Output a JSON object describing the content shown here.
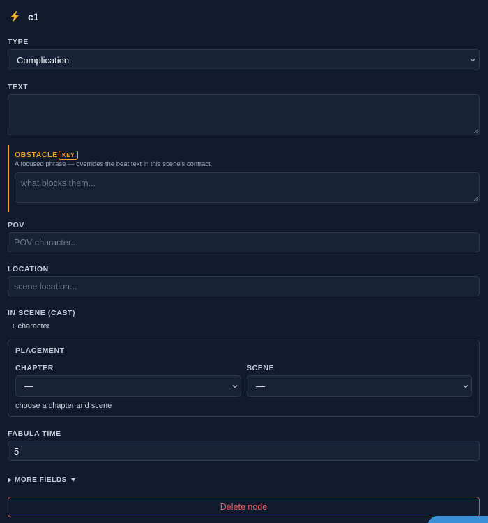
{
  "header": {
    "icon": "lightning-icon",
    "title": "c1"
  },
  "type_field": {
    "label": "TYPE",
    "value": "Complication"
  },
  "text_field": {
    "label": "TEXT",
    "value": ""
  },
  "obstacle": {
    "label": "OBSTACLE",
    "badge": "KEY",
    "help": "A focused phrase — overrides the beat text in this scene's contract.",
    "placeholder": "what blocks them...",
    "accent_color": "#f5a524"
  },
  "pov": {
    "label": "POV",
    "placeholder": "POV character..."
  },
  "location": {
    "label": "LOCATION",
    "placeholder": "scene location..."
  },
  "cast": {
    "label": "IN SCENE (CAST)",
    "add_label": "+ character"
  },
  "placement": {
    "label": "PLACEMENT",
    "chapter_label": "CHAPTER",
    "chapter_value": "—",
    "scene_label": "SCENE",
    "scene_value": "—",
    "hint": "choose a chapter and scene"
  },
  "fabula_time": {
    "label": "FABULA TIME",
    "value": "5"
  },
  "more_fields": {
    "label": "MORE FIELDS"
  },
  "delete": {
    "label": "Delete node",
    "color": "#e05252"
  }
}
